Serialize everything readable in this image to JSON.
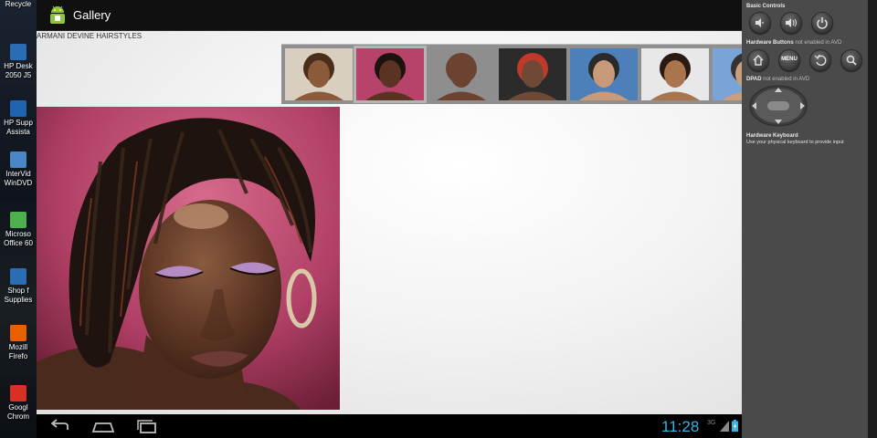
{
  "desktop": {
    "icons": [
      {
        "label": "Recycle",
        "icon": "recycle-bin-icon",
        "color": "#7fa6c9"
      },
      {
        "label": "HP Desk\n2050 J5",
        "icon": "printer-icon",
        "color": "#2b6db5"
      },
      {
        "label": "HP Supp\nAssista",
        "icon": "help-icon",
        "color": "#1f64b0"
      },
      {
        "label": "InterVid\nWinDVD",
        "icon": "dvd-icon",
        "color": "#4a87c7"
      },
      {
        "label": "Microso\nOffice 60",
        "icon": "office-icon",
        "color": "#4caf50"
      },
      {
        "label": "Shop f\nSupplies",
        "icon": "shop-icon",
        "color": "#2b6db5"
      },
      {
        "label": "Mozill\nFirefo",
        "icon": "firefox-icon",
        "color": "#e66000"
      },
      {
        "label": "Googl\nChrom",
        "icon": "chrome-icon",
        "color": "#d93025"
      }
    ]
  },
  "app": {
    "title": "Gallery",
    "subtitle": "ARMANI DEVINE HAIRSTYLES",
    "accent": "#33b5e5"
  },
  "gallery": {
    "selected_index": 1,
    "thumbnails": [
      {
        "name": "thumb-woman-afro-puff",
        "bg": "#d9cfc0",
        "skin": "#8a5a3a",
        "hair": "#4a2e1c"
      },
      {
        "name": "thumb-woman-locs",
        "bg": "#b8436a",
        "skin": "#5a3322",
        "hair": "#1c120e"
      },
      {
        "name": "thumb-man-bald",
        "bg": "#8e8e8e",
        "skin": "#6b4330",
        "hair": "#6b4330"
      },
      {
        "name": "thumb-woman-red-mohawk",
        "bg": "#2b2b2b",
        "skin": "#6e4a35",
        "hair": "#c0392b"
      },
      {
        "name": "thumb-man-fade",
        "bg": "#4d7fb8",
        "skin": "#c89a7a",
        "hair": "#2a2a2a"
      },
      {
        "name": "thumb-man-short",
        "bg": "#e8e8e8",
        "skin": "#a8754f",
        "hair": "#2a1a12"
      },
      {
        "name": "thumb-partial",
        "bg": "#7aa3d6",
        "skin": "#c8a080",
        "hair": "#333333"
      }
    ]
  },
  "status": {
    "time": "11:28",
    "signal": "3G"
  },
  "panel": {
    "basic_controls": "Basic Controls",
    "hardware_buttons": "Hardware Buttons",
    "hardware_buttons_note": "not enabled in AVD",
    "menu_label": "MENU",
    "dpad": "DPAD",
    "dpad_note": "not enabled in AVD",
    "keyboard_title": "Hardware Keyboard",
    "keyboard_note": "Use your physical keyboard to provide input"
  }
}
